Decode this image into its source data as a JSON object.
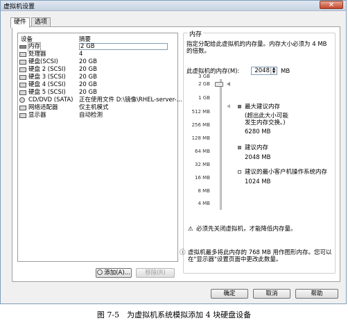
{
  "window": {
    "title": "虚拟机设置",
    "close": "✕"
  },
  "tabs": [
    {
      "label": "硬件"
    },
    {
      "label": "选项"
    }
  ],
  "device_list": {
    "col_device": "设备",
    "col_summary": "摘要",
    "rows": [
      {
        "name": "内存",
        "summary": "2 GB",
        "icon": "memory-icon"
      },
      {
        "name": "处理器",
        "summary": "4",
        "icon": "processor-icon"
      },
      {
        "name": "硬盘(SCSI)",
        "summary": "20 GB",
        "icon": "hard-disk-icon"
      },
      {
        "name": "硬盘 2 (SCSI)",
        "summary": "20 GB",
        "icon": "hard-disk-icon"
      },
      {
        "name": "硬盘 3 (SCSI)",
        "summary": "20 GB",
        "icon": "hard-disk-icon"
      },
      {
        "name": "硬盘 4 (SCSI)",
        "summary": "20 GB",
        "icon": "hard-disk-icon"
      },
      {
        "name": "硬盘 5 (SCSI)",
        "summary": "20 GB",
        "icon": "hard-disk-icon"
      },
      {
        "name": "CD/DVD (SATA)",
        "summary": "正在使用文件 D:\\镜像\\RHEL-server-...",
        "icon": "cd-dvd-icon"
      },
      {
        "name": "网络适配器",
        "summary": "仅主机模式",
        "icon": "network-adapter-icon"
      },
      {
        "name": "显示器",
        "summary": "自动检测",
        "icon": "display-icon"
      }
    ],
    "add_button": "添加(A)...",
    "remove_button": "移除(R)"
  },
  "memory": {
    "group_title": "内存",
    "desc_line1": "指定分配给此虚拟机的内存量。内存大小必须为 4 MB",
    "desc_line2": "的倍数。",
    "field_label": "此虚拟机的内存(M):",
    "value": "2048",
    "unit": "MB",
    "scale": [
      "3 GB",
      "2 GB",
      "1 GB",
      "512 MB",
      "256 MB",
      "128 MB",
      "64 MB",
      "32 MB",
      "16 MB",
      "8 MB",
      "4 MB"
    ],
    "max_recommended_label": "最大建议内存",
    "max_recommended_note1": "(超出此大小可能",
    "max_recommended_note2": "发生内存交换。)",
    "max_recommended_value": "6280 MB",
    "recommended_label": "建议内存",
    "recommended_value": "2048 MB",
    "min_guest_label": "建议的最小客户机操作系统内存",
    "min_guest_value": "1024 MB",
    "warning": "必须先关闭虚拟机，才能降低内存量。",
    "info_line1": "虚拟机最多将此内存的 768 MB 用作图形内存。您可以",
    "info_line2": "在\"显示器\"设置页面中更改此数量。",
    "colors": {
      "max_marker": "#6e6e6e",
      "recommended_marker": "#7a7a7a",
      "min_marker": "#ffffff"
    }
  },
  "footer": {
    "ok": "确定",
    "cancel": "取消",
    "help": "帮助"
  },
  "caption": "图 7-5　为虚拟机系统模拟添加 4 块硬盘设备"
}
